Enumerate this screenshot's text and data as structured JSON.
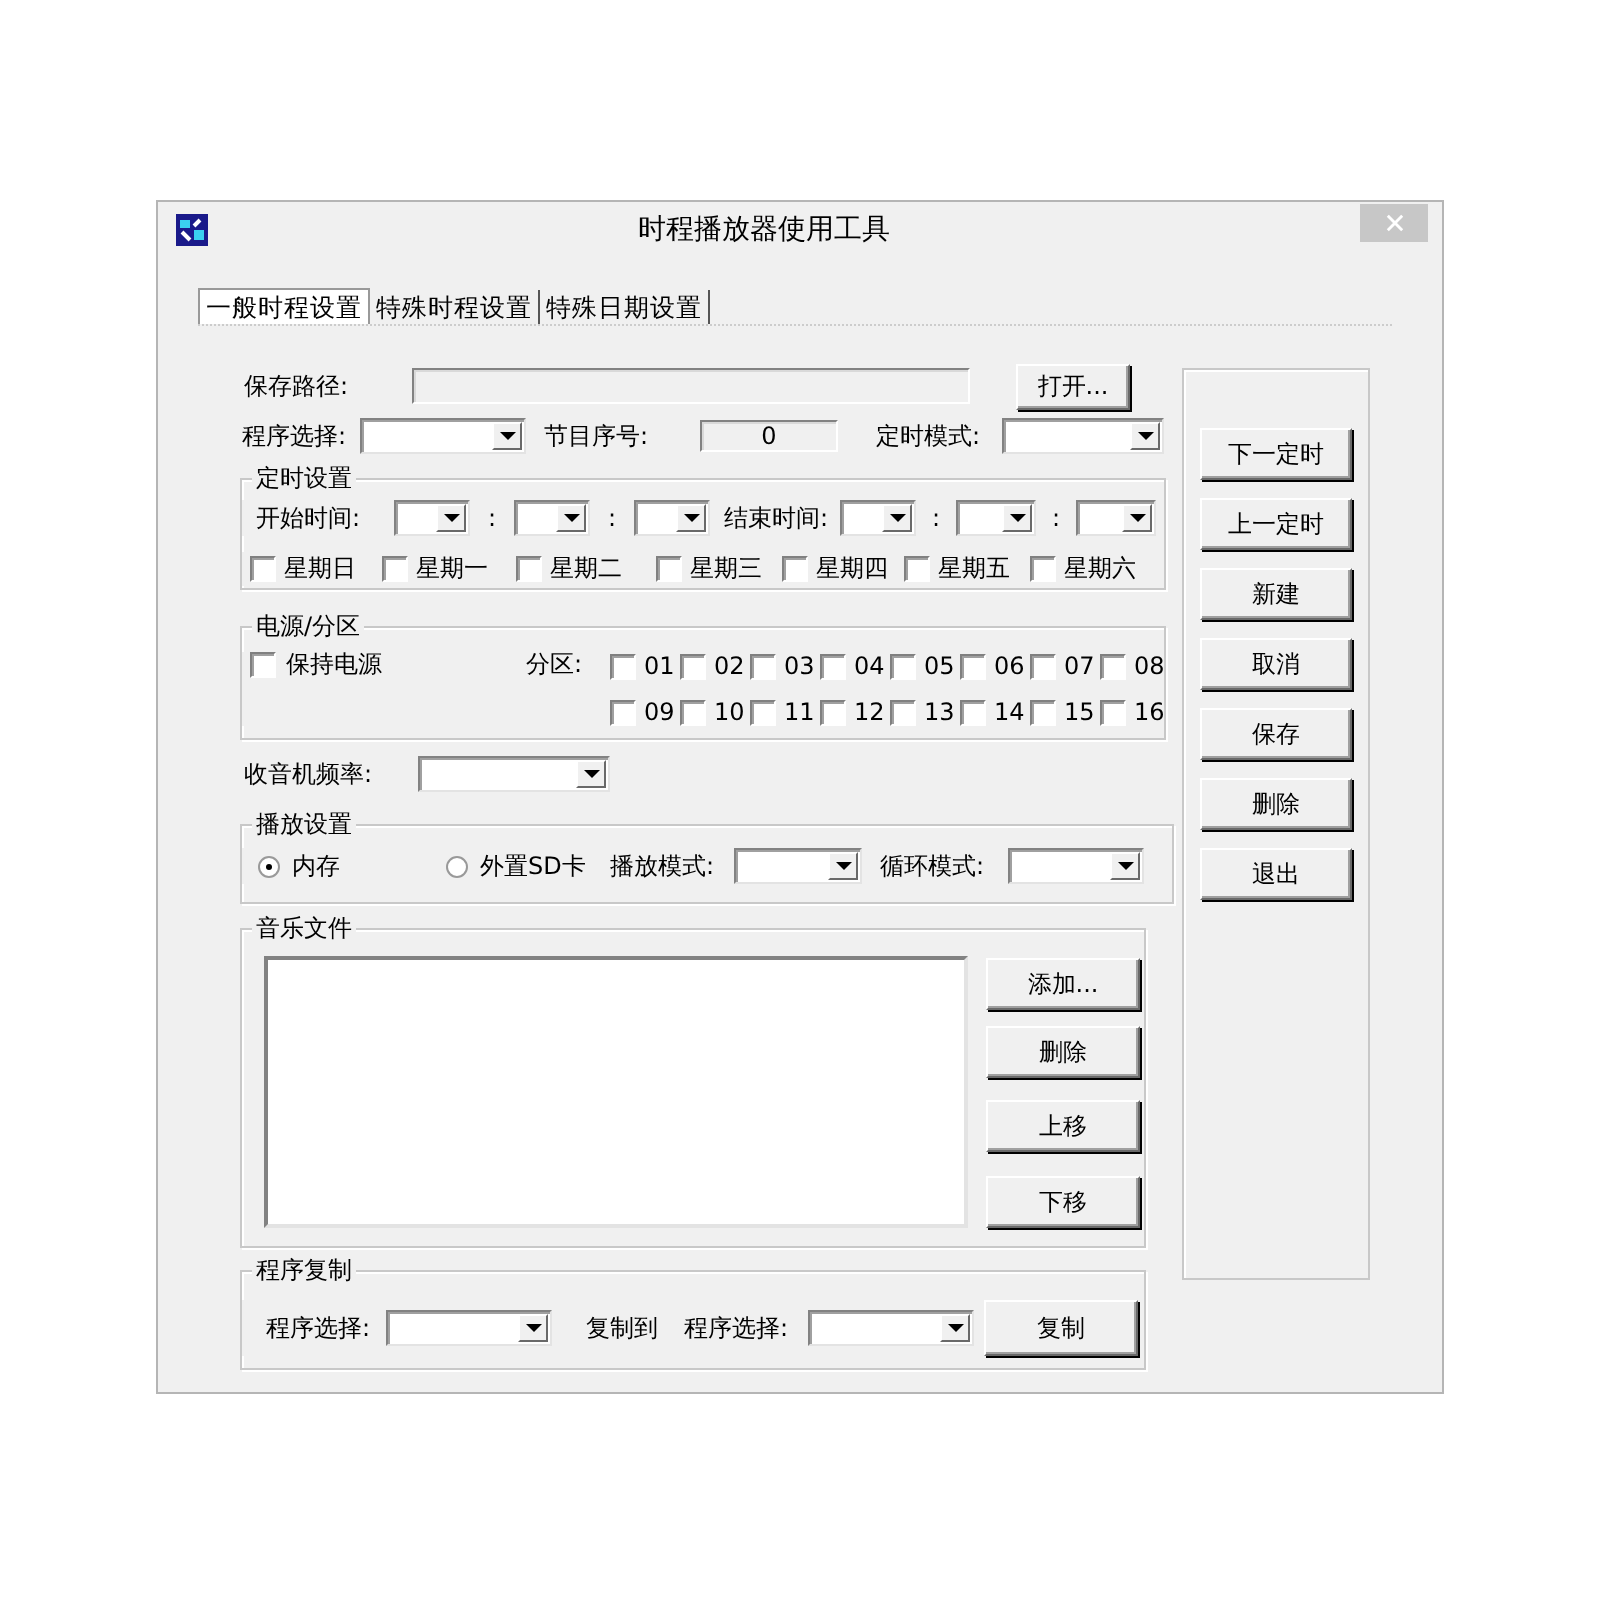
{
  "window": {
    "title": "时程播放器使用工具"
  },
  "tabs": [
    {
      "label": "一般时程设置",
      "selected": true
    },
    {
      "label": "特殊时程设置",
      "selected": false
    },
    {
      "label": "特殊日期设置",
      "selected": false
    }
  ],
  "save_path": {
    "label": "保存路径:",
    "button": "打开..."
  },
  "program_select": {
    "label": "程序选择:"
  },
  "item_number": {
    "label": "节目序号:",
    "value": "0"
  },
  "timer_mode": {
    "label": "定时模式:"
  },
  "timer_settings": {
    "title": "定时设置",
    "start_label": "开始时间:",
    "start_separators": [
      ":",
      ":"
    ],
    "end_label": "结束时间:",
    "end_separators": [
      ":",
      ":"
    ],
    "weekdays": [
      {
        "label": "星期日",
        "checked": false
      },
      {
        "label": "星期一",
        "checked": false
      },
      {
        "label": "星期二",
        "checked": false
      },
      {
        "label": "星期三",
        "checked": false
      },
      {
        "label": "星期四",
        "checked": false
      },
      {
        "label": "星期五",
        "checked": false
      },
      {
        "label": "星期六",
        "checked": false
      }
    ]
  },
  "power_zone": {
    "title": "电源/分区",
    "keep_power": {
      "label": "保持电源",
      "checked": false
    },
    "zone_label": "分区:",
    "zones": [
      {
        "label": "01",
        "checked": false
      },
      {
        "label": "02",
        "checked": false
      },
      {
        "label": "03",
        "checked": false
      },
      {
        "label": "04",
        "checked": false
      },
      {
        "label": "05",
        "checked": false
      },
      {
        "label": "06",
        "checked": false
      },
      {
        "label": "07",
        "checked": false
      },
      {
        "label": "08",
        "checked": false
      },
      {
        "label": "09",
        "checked": false
      },
      {
        "label": "10",
        "checked": false
      },
      {
        "label": "11",
        "checked": false
      },
      {
        "label": "12",
        "checked": false
      },
      {
        "label": "13",
        "checked": false
      },
      {
        "label": "14",
        "checked": false
      },
      {
        "label": "15",
        "checked": false
      },
      {
        "label": "16",
        "checked": false
      }
    ]
  },
  "radio_frequency": {
    "label": "收音机频率:"
  },
  "playback": {
    "title": "播放设置",
    "sources": [
      {
        "label": "内存",
        "selected": true
      },
      {
        "label": "外置SD卡",
        "selected": false
      }
    ],
    "play_mode": {
      "label": "播放模式:"
    },
    "loop_mode": {
      "label": "循环模式:"
    }
  },
  "music_files": {
    "title": "音乐文件",
    "buttons": [
      "添加...",
      "删除",
      "上移",
      "下移"
    ]
  },
  "program_copy": {
    "title": "程序复制",
    "source_label": "程序选择:",
    "copy_to": "复制到",
    "target_label": "程序选择:",
    "button": "复制"
  },
  "side_buttons": [
    "下一定时",
    "上一定时",
    "新建",
    "取消",
    "保存",
    "删除",
    "退出"
  ]
}
